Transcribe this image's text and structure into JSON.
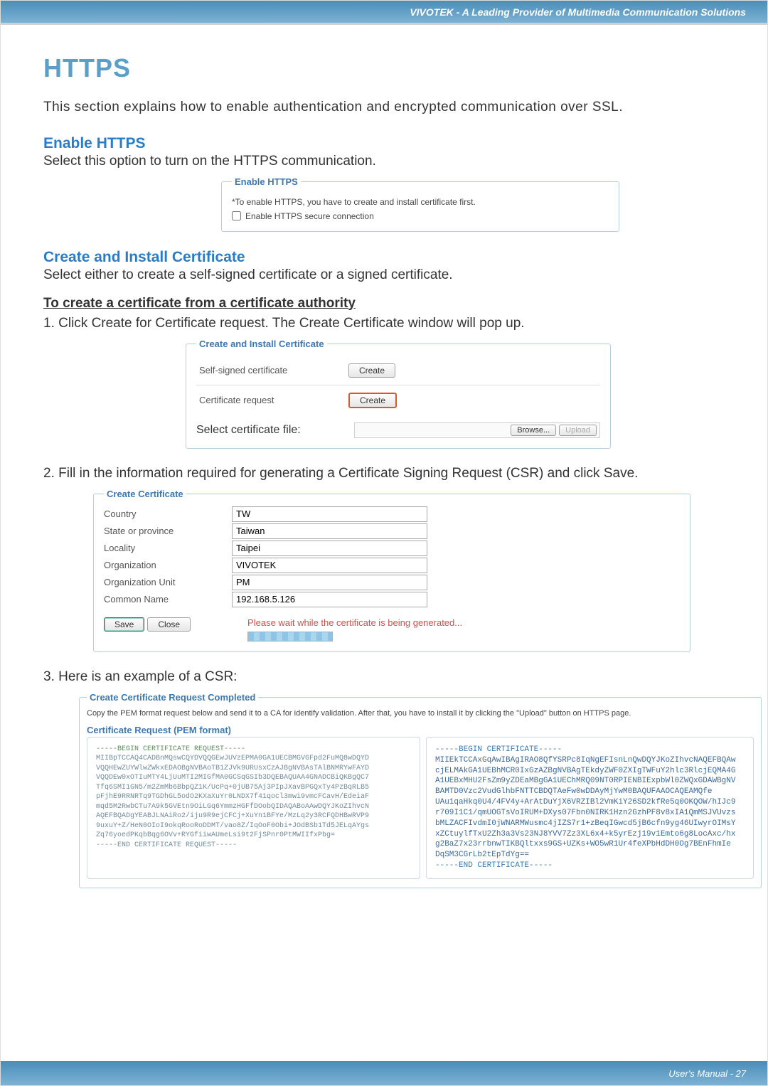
{
  "header_banner": "VIVOTEK - A Leading Provider of Multimedia Communication Solutions",
  "title": "HTTPS",
  "intro": "This section explains how to enable authentication and encrypted communication over SSL.",
  "s1": {
    "heading": "Enable HTTPS",
    "text": "Select this option to turn on the HTTPS communication.",
    "fieldset_legend": "Enable HTTPS",
    "note": "*To enable HTTPS, you have to create and install certificate first.",
    "checkbox_label": "Enable HTTPS secure connection"
  },
  "s2": {
    "heading": "Create and Install Certificate",
    "text": "Select either to create a self-signed certificate or a signed certificate."
  },
  "s3": {
    "heading": "To create a certificate from a certificate authority",
    "step1": "1. Click Create for Certificate request. The Create Certificate window will pop up.",
    "fieldset_legend": "Create and Install Certificate",
    "row_self_signed": "Self-signed certificate",
    "btn_create": "Create",
    "row_cert_request": "Certificate request",
    "row_select_file": "Select certificate file:",
    "btn_browse": "Browse...",
    "btn_upload": "Upload"
  },
  "s4": {
    "step2": "2. Fill in the information required for generating a Certificate Signing Request (CSR) and click Save.",
    "fieldset_legend": "Create Certificate",
    "fields": {
      "country": {
        "label": "Country",
        "value": "TW"
      },
      "state": {
        "label": "State or province",
        "value": "Taiwan"
      },
      "locality": {
        "label": "Locality",
        "value": "Taipei"
      },
      "org": {
        "label": "Organization",
        "value": "VIVOTEK"
      },
      "org_unit": {
        "label": "Organization Unit",
        "value": "PM"
      },
      "common_name": {
        "label": "Common Name",
        "value": "192.168.5.126"
      }
    },
    "btn_save": "Save",
    "btn_close": "Close",
    "wait_msg": "Please wait while the certificate is being generated..."
  },
  "s5": {
    "step3": "3. Here is an example of a CSR:",
    "fieldset_legend": "Create Certificate Request Completed",
    "instruction": "Copy the PEM format request below and send it to a CA for identify validation. After that, you have to install it by clicking the \"Upload\" button on HTTPS page.",
    "pem_legend": "Certificate Request (PEM format)",
    "pem_begin": "-----BEGIN CERTIFICATE REQUEST-----",
    "pem_lines": [
      "MIIBpTCCAQ4CADBnMQswCQYDVQQGEwJUVzEPMA0GA1UECBMGVGFpd2FuMQ8wDQYD",
      "VQQHEwZUYWlwZWkxEDAOBgNVBAoTB1ZJVk9URUsxCzAJBgNVBAsTAlBNMRYwFAYD",
      "VQQDEw0xOTIuMTY4LjUuMTI2MIGfMA0GCSqGSIb3DQEBAQUAA4GNADCBiQKBgQC7",
      "Tfq6SMI1GN5/m2ZmMb6BbpQZ1K/UcPq+0jUB75Aj3PIpJXavBPGQxTy4PzBqRLB5",
      "pFjhE9RRNRTq9TGDhGL5odO2KXaXuYr0LNDX7f41qocl3mwi9vmcFCavH/EdeiaF",
      "mqd5M2RwbCTu7A9k5GVEtn9OiLGq6YmmzHGFfDOobQIDAQABoAAwDQYJKoZIhvcN",
      "AQEFBQADgYEABJLNAiRo2/iju9R9ejCFCj+XuYn1BFYe/MzLq2y3RCFQDHBwRVP9",
      "9uxuY+Z/HeN0OIoI9okqRooRoDDMT/vao8Z/IqOoF0Obi+JOdBSb1Td5JELqAYgs",
      "Zq76yoedPKqbBqg6OVv+RYGfiiwAUmeLsi9t2FjSPnr0PtMWIIfxPbg=",
      "-----END CERTIFICATE REQUEST-----"
    ],
    "cert_begin": "-----BEGIN CERTIFICATE-----",
    "cert_lines": [
      "MIIEkTCCAxGqAwIBAgIRAO8QfYSRPc8IqNgEFIsnLnQwDQYJKoZIhvcNAQEFBQAw",
      "cjELMAkGA1UEBhMCR0IxGzAZBgNVBAgTEkdyZWF0ZXIgTWFuY2hlc3RlcjEQMA4G",
      "A1UEBxMHU2FsZm9yZDEaMBgGA1UEChMRQ09NT0RPIENBIExpbWl0ZWQxGDAWBgNV",
      "BAMTD0Vzc2VudGlhbFNTTCBDQTAeFw0wDDAyMjYwM0BAQUFAAOCAQEAMQfe",
      "UAu1qaHkq0U4/4FV4y+ArAtDuYjX6VRZIBl2VmKiY26SD2kfRe5q0OKQOW/hIJc9",
      "r709I1C1/qmUOGTsVoIRUM+DXys07Fbn0NIRK1Hzn2GzhPF8v8xIA1QmMSJVUvzs",
      "bMLZACFIvdmI0jWNARMWusmc4jIZS7r1+zBeqIGwcd5jB6cfn9yg46UIwyrOIMsY",
      "xZCtuylfTxU2Zh3a3Vs23NJ8YVV7Zz3XL6x4+k5yrEzj19v1Emto6g8LocAxc/hx",
      "g2BaZ7x23rrbnwTIKBQltxxs9GS+UZKs+WO5wR1Ur4feXPbHdDH0Og7BEnFhmIe",
      "DqSM3CGrLb2tEpTdYg=="
    ],
    "cert_end": "-----END CERTIFICATE-----"
  },
  "footer": "User's Manual - 27"
}
